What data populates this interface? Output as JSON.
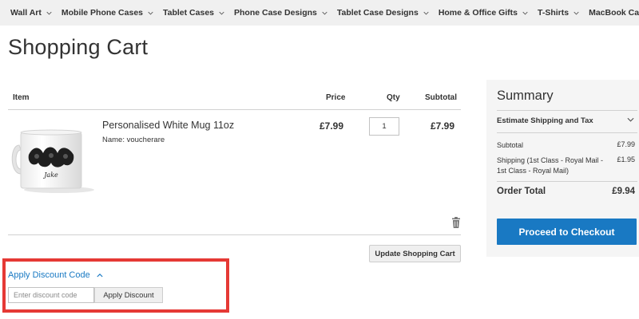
{
  "nav": {
    "items": [
      {
        "label": "Wall Art"
      },
      {
        "label": "Mobile Phone Cases"
      },
      {
        "label": "Tablet Cases"
      },
      {
        "label": "Phone Case Designs"
      },
      {
        "label": "Tablet Case Designs"
      },
      {
        "label": "Home & Office Gifts"
      },
      {
        "label": "T-Shirts"
      },
      {
        "label": "MacBook Cases"
      }
    ]
  },
  "page": {
    "title": "Shopping Cart"
  },
  "cart": {
    "headers": {
      "item": "Item",
      "price": "Price",
      "qty": "Qty",
      "subtotal": "Subtotal"
    },
    "items": [
      {
        "name": "Personalised White Mug 11oz",
        "option": "Name: voucherare",
        "image_text": "Jake",
        "price": "£7.99",
        "qty": "1",
        "subtotal": "£7.99"
      }
    ],
    "update_label": "Update Shopping Cart"
  },
  "discount": {
    "toggle_label": "Apply Discount Code",
    "placeholder": "Enter discount code",
    "button_label": "Apply Discount",
    "highlight_color": "#e53935"
  },
  "summary": {
    "title": "Summary",
    "estimate_label": "Estimate Shipping and Tax",
    "subtotal_label": "Subtotal",
    "subtotal_value": "£7.99",
    "shipping_label_line1": "Shipping (1st Class - Royal Mail -",
    "shipping_label_line2": "1st Class - Royal Mail)",
    "shipping_value": "£1.95",
    "order_total_label": "Order Total",
    "order_total_value": "£9.94",
    "checkout_label": "Proceed to Checkout"
  },
  "colors": {
    "accent": "#1979c3",
    "nav_bg": "#f0f0f0",
    "summary_bg": "#f5f5f5"
  },
  "icons": {
    "nav_dropdown": "chevron-down-icon",
    "discount_toggle": "chevron-up-icon",
    "remove_item": "trash-icon",
    "estimate_toggle": "chevron-down-icon"
  }
}
